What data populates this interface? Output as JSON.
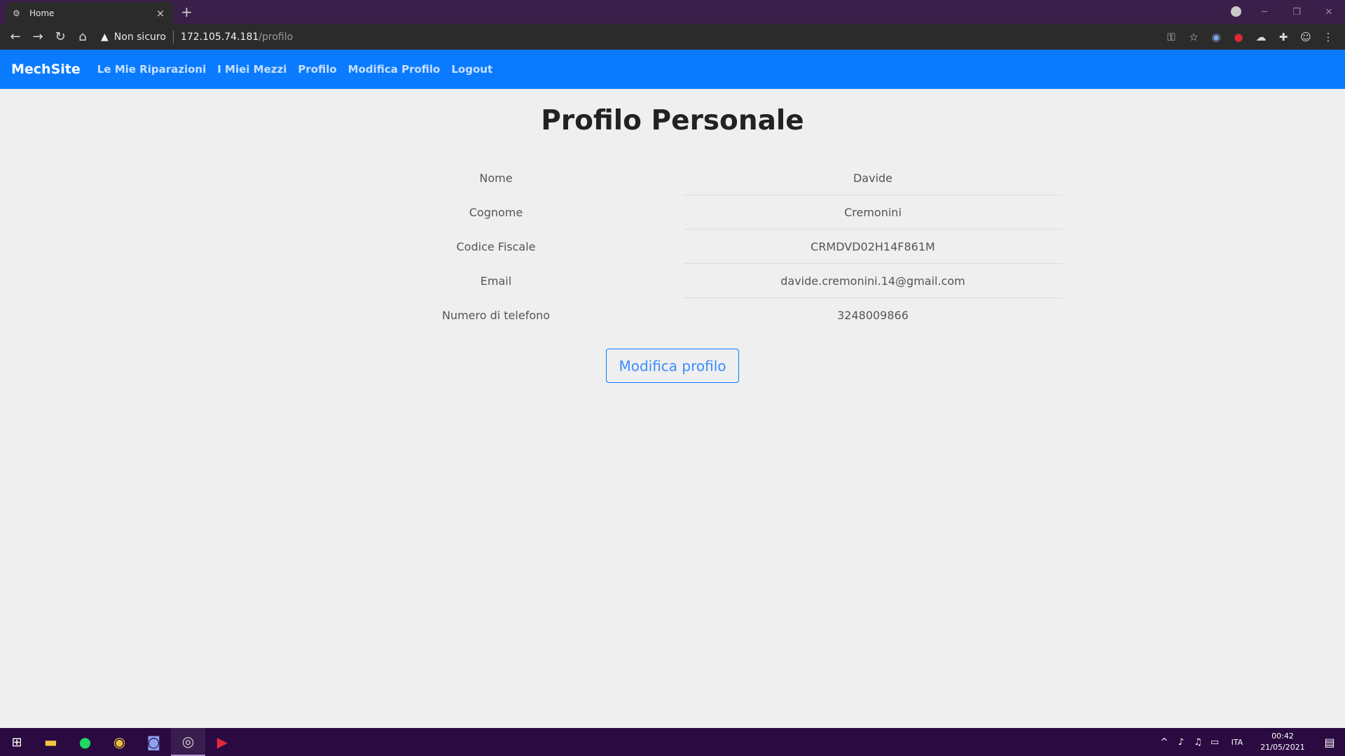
{
  "browser": {
    "tab_title": "Home",
    "security_label": "Non sicuro",
    "url_host": "172.105.74.181",
    "url_path": "/profilo"
  },
  "navbar": {
    "brand": "MechSite",
    "links": [
      "Le Mie Riparazioni",
      "I Miei Mezzi",
      "Profilo",
      "Modifica Profilo",
      "Logout"
    ]
  },
  "main": {
    "title": "Profilo Personale",
    "fields": [
      {
        "label": "Nome",
        "value": "Davide"
      },
      {
        "label": "Cognome",
        "value": "Cremonini"
      },
      {
        "label": "Codice Fiscale",
        "value": "CRMDVD02H14F861M"
      },
      {
        "label": "Email",
        "value": "davide.cremonini.14@gmail.com"
      },
      {
        "label": "Numero di telefono",
        "value": "3248009866"
      }
    ],
    "edit_button": "Modifica profilo"
  },
  "taskbar": {
    "language": "ITA",
    "time": "00:42",
    "date": "21/05/2021",
    "apps": [
      "file-explorer-icon",
      "spotify-icon",
      "chrome-icon",
      "discord-icon",
      "obs-icon",
      "media-player-icon"
    ]
  },
  "colors": {
    "accent": "#0a7bff",
    "taskbar": "#2a0a40",
    "page_background": "#efefef"
  }
}
